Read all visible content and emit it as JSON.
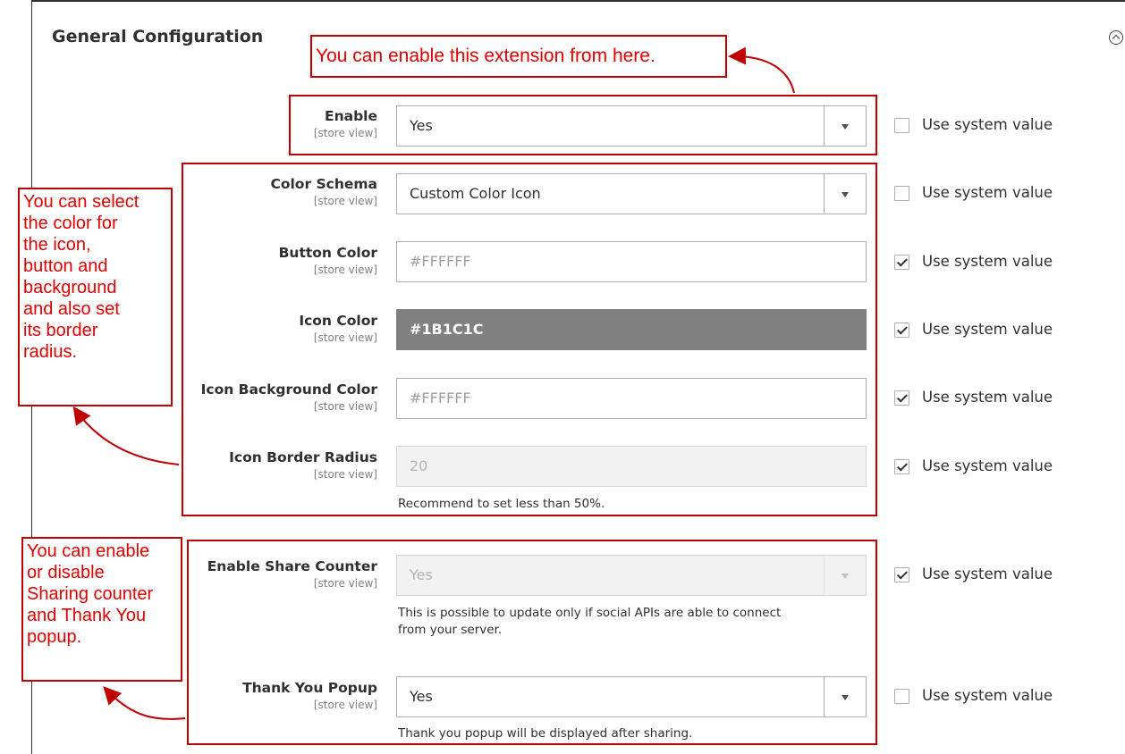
{
  "section": {
    "title": "General Configuration"
  },
  "scope_label": "[store view]",
  "system_value_label": "Use system value",
  "fields": {
    "enable": {
      "label": "Enable",
      "value": "Yes",
      "use_system_value": false
    },
    "color_schema": {
      "label": "Color Schema",
      "value": "Custom Color Icon",
      "use_system_value": false
    },
    "button_color": {
      "label": "Button Color",
      "value": "#FFFFFF",
      "use_system_value": true
    },
    "icon_color": {
      "label": "Icon Color",
      "value": "#1B1C1C",
      "use_system_value": true
    },
    "icon_background_color": {
      "label": "Icon Background Color",
      "value": "#FFFFFF",
      "use_system_value": true
    },
    "icon_border_radius": {
      "label": "Icon Border Radius",
      "value": "20",
      "note": "Recommend to set less than 50%.",
      "use_system_value": true
    },
    "enable_share_counter": {
      "label": "Enable Share Counter",
      "value": "Yes",
      "note_line1": "This is possible to update only if social APIs are able to connect",
      "note_line2": "from your server.",
      "use_system_value": true
    },
    "thank_you_popup": {
      "label": "Thank You Popup",
      "value": "Yes",
      "note": "Thank you popup will be displayed after sharing.",
      "use_system_value": false
    }
  },
  "annotations": {
    "enable_note": "You can enable this extension from here.",
    "color_note": [
      "You can select",
      "the color for",
      "the icon,",
      "button and",
      "background",
      "and also set",
      "its border",
      "radius."
    ],
    "counter_note": [
      "You can enable",
      "or disable",
      "Sharing counter",
      "and Thank You",
      "popup."
    ]
  },
  "colors": {
    "annotation": "#c00000",
    "icon_color_fill": "#808080"
  }
}
